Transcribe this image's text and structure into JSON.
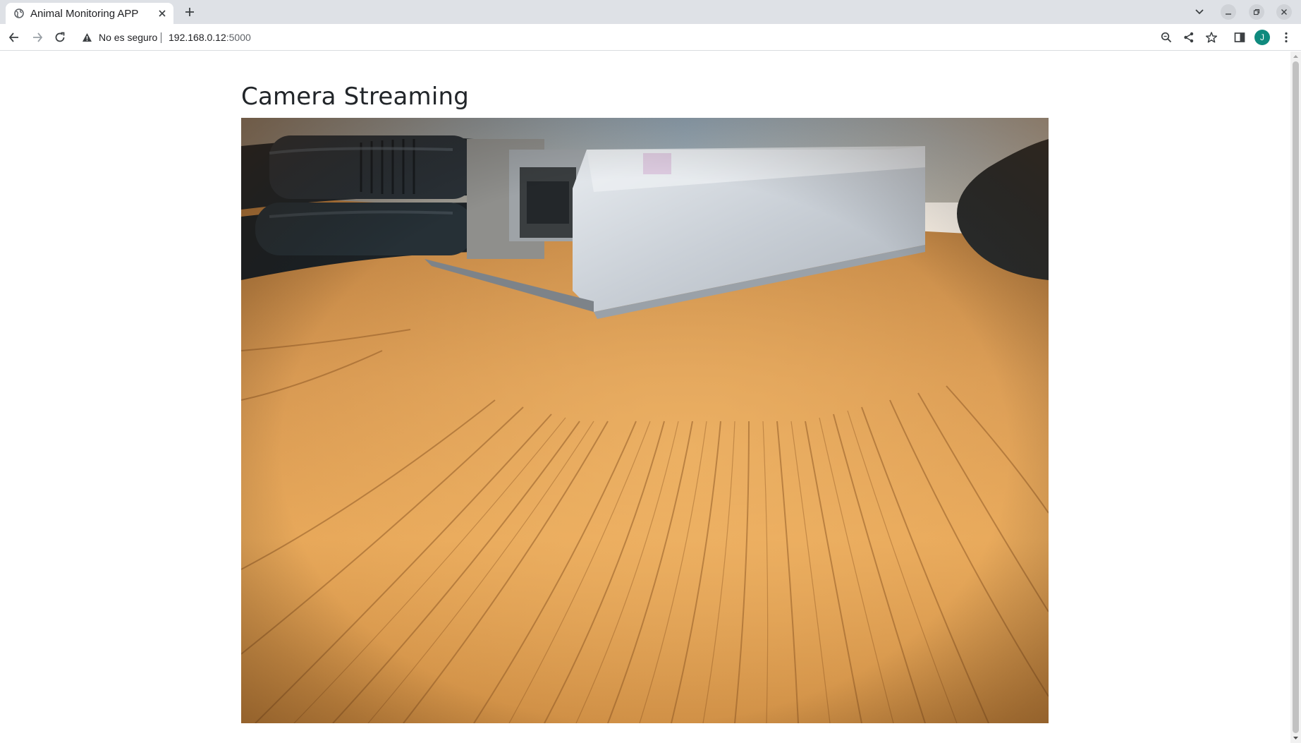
{
  "browser": {
    "tab": {
      "title": "Animal Monitoring APP"
    },
    "address_bar": {
      "security_text": "No es seguro",
      "url_host": "192.168.0.12",
      "url_port": ":5000"
    },
    "profile": {
      "initial": "J",
      "color": "#0f8a7e"
    }
  },
  "page": {
    "title": "Camera Streaming",
    "stream": {
      "description": "Live camera feed image showing a silver Raspberry Pi case with black cables on a wooden table"
    }
  },
  "icons": {
    "tab_favicon": "globe-icon",
    "tab_close": "close-icon",
    "new_tab": "plus-icon",
    "tab_list": "chevron-down-icon",
    "minimize": "minimize-icon",
    "restore": "restore-icon",
    "close_window": "close-icon",
    "back": "arrow-left-icon",
    "forward": "arrow-right-icon",
    "reload": "reload-icon",
    "security": "warning-icon",
    "zoom": "magnifier-icon",
    "share": "share-icon",
    "bookmark": "star-icon",
    "side_panel": "side-panel-icon",
    "menu": "kebab-menu-icon"
  }
}
